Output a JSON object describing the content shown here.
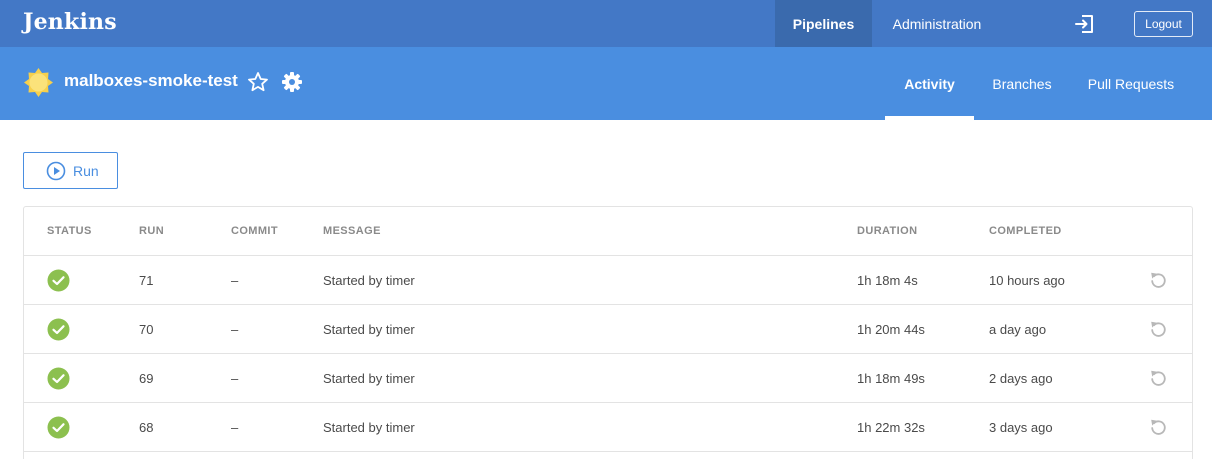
{
  "header": {
    "logo": "Jenkins",
    "nav": {
      "pipelines": "Pipelines",
      "administration": "Administration"
    },
    "logout_label": "Logout"
  },
  "pipeline": {
    "name": "malboxes-smoke-test",
    "tabs": {
      "activity": "Activity",
      "branches": "Branches",
      "pull_requests": "Pull Requests"
    }
  },
  "run_button": {
    "label": "Run"
  },
  "table": {
    "columns": {
      "status": "STATUS",
      "run": "RUN",
      "commit": "COMMIT",
      "message": "MESSAGE",
      "duration": "DURATION",
      "completed": "COMPLETED"
    },
    "rows": [
      {
        "status": "success",
        "run": "71",
        "commit": "–",
        "message": "Started by timer",
        "duration": "1h 18m 4s",
        "completed": "10 hours ago"
      },
      {
        "status": "success",
        "run": "70",
        "commit": "–",
        "message": "Started by timer",
        "duration": "1h 20m 44s",
        "completed": "a day ago"
      },
      {
        "status": "success",
        "run": "69",
        "commit": "–",
        "message": "Started by timer",
        "duration": "1h 18m 49s",
        "completed": "2 days ago"
      },
      {
        "status": "success",
        "run": "68",
        "commit": "–",
        "message": "Started by timer",
        "duration": "1h 22m 32s",
        "completed": "3 days ago"
      }
    ]
  },
  "colors": {
    "topbar": "#4378c6",
    "topbar_active": "#3a6aad",
    "subheader": "#4a8ee0",
    "success": "#8cc04f",
    "weather": "#f6d04d"
  },
  "icons": {
    "weather": "sun-icon",
    "favorite": "star-outline-icon",
    "settings": "gear-icon",
    "signout": "sign-out-icon",
    "run": "play-circle-icon",
    "status": "check-circle-icon",
    "replay": "replay-icon"
  }
}
